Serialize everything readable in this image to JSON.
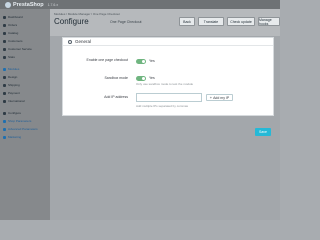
{
  "brand": {
    "name": "PrestaShop",
    "version": "1.7.6.x"
  },
  "breadcrumb": "Modules / Module Manager / One Page Checkout",
  "header": {
    "title": "Configure",
    "subtitle": "One Page Checkout",
    "buttons": [
      "Back",
      "Translate",
      "Check update",
      "Manage hooks"
    ]
  },
  "sidebar": {
    "items": [
      "Dashboard",
      "Orders",
      "Catalog",
      "Customers",
      "Customer Service",
      "Stats",
      "Modules",
      "Design",
      "Shipping",
      "Payment",
      "International",
      "Configure",
      "Shop Parameters",
      "Advanced Parameters",
      "Marketing"
    ]
  },
  "modal": {
    "title": "General",
    "rows": {
      "enable_label": "Enable one page checkout",
      "enable_value": "Yes",
      "sandbox_label": "Sandbox mode",
      "sandbox_value": "Yes",
      "sandbox_help": "Only use sandbox mode to test the module",
      "ip_label": "Add IP address",
      "ip_placeholder": "",
      "add_ip_label": "Add my IP",
      "ip_help": "Add multiple IPs separated by commas"
    },
    "save_label": "Save"
  },
  "colors": {
    "accent": "#25b9d7",
    "toggle_on": "#70b580"
  }
}
